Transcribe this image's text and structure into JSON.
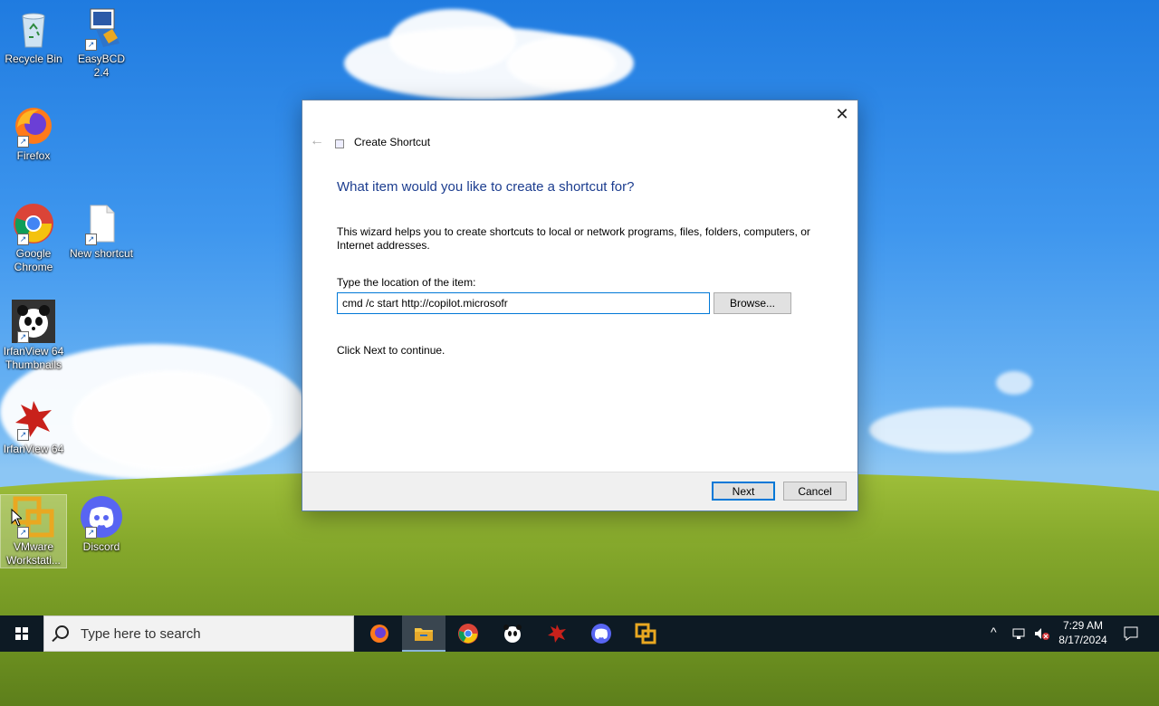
{
  "desktop": {
    "icons": [
      {
        "label": "Recycle Bin",
        "icon": "recycle-bin-icon"
      },
      {
        "label": "EasyBCD 2.4",
        "icon": "easybcd-icon"
      },
      {
        "label": "Firefox",
        "icon": "firefox-icon"
      },
      {
        "label": "Google Chrome",
        "icon": "chrome-icon"
      },
      {
        "label": "New shortcut",
        "icon": "file-icon"
      },
      {
        "label": "IrfanView 64 Thumbnails",
        "icon": "panda-icon"
      },
      {
        "label": "IrfanView 64",
        "icon": "irfanview-icon"
      },
      {
        "label": "VMware Workstati...",
        "icon": "vmware-icon"
      },
      {
        "label": "Discord",
        "icon": "discord-icon"
      }
    ]
  },
  "dialog": {
    "window_title": "Create Shortcut",
    "heading": "What item would you like to create a shortcut for?",
    "description": "This wizard helps you to create shortcuts to local or network programs, files, folders, computers, or Internet addresses.",
    "location_label": "Type the location of the item:",
    "location_value": "cmd /c start http://copilot.microsofr",
    "browse_label": "Browse...",
    "continue_text": "Click Next to continue.",
    "next_label": "Next",
    "cancel_label": "Cancel",
    "close_glyph": "✕"
  },
  "taskbar": {
    "search_placeholder": "Type here to search",
    "apps": [
      "firefox-icon",
      "file-explorer-icon",
      "chrome-icon",
      "panda-icon",
      "irfanview-icon",
      "discord-icon",
      "vmware-icon"
    ],
    "active_app": "file-explorer-icon",
    "time": "7:29 AM",
    "date": "8/17/2024"
  },
  "colors": {
    "accent": "#0078d7",
    "heading": "#1c3d8f",
    "taskbar": "#0d1a24"
  }
}
